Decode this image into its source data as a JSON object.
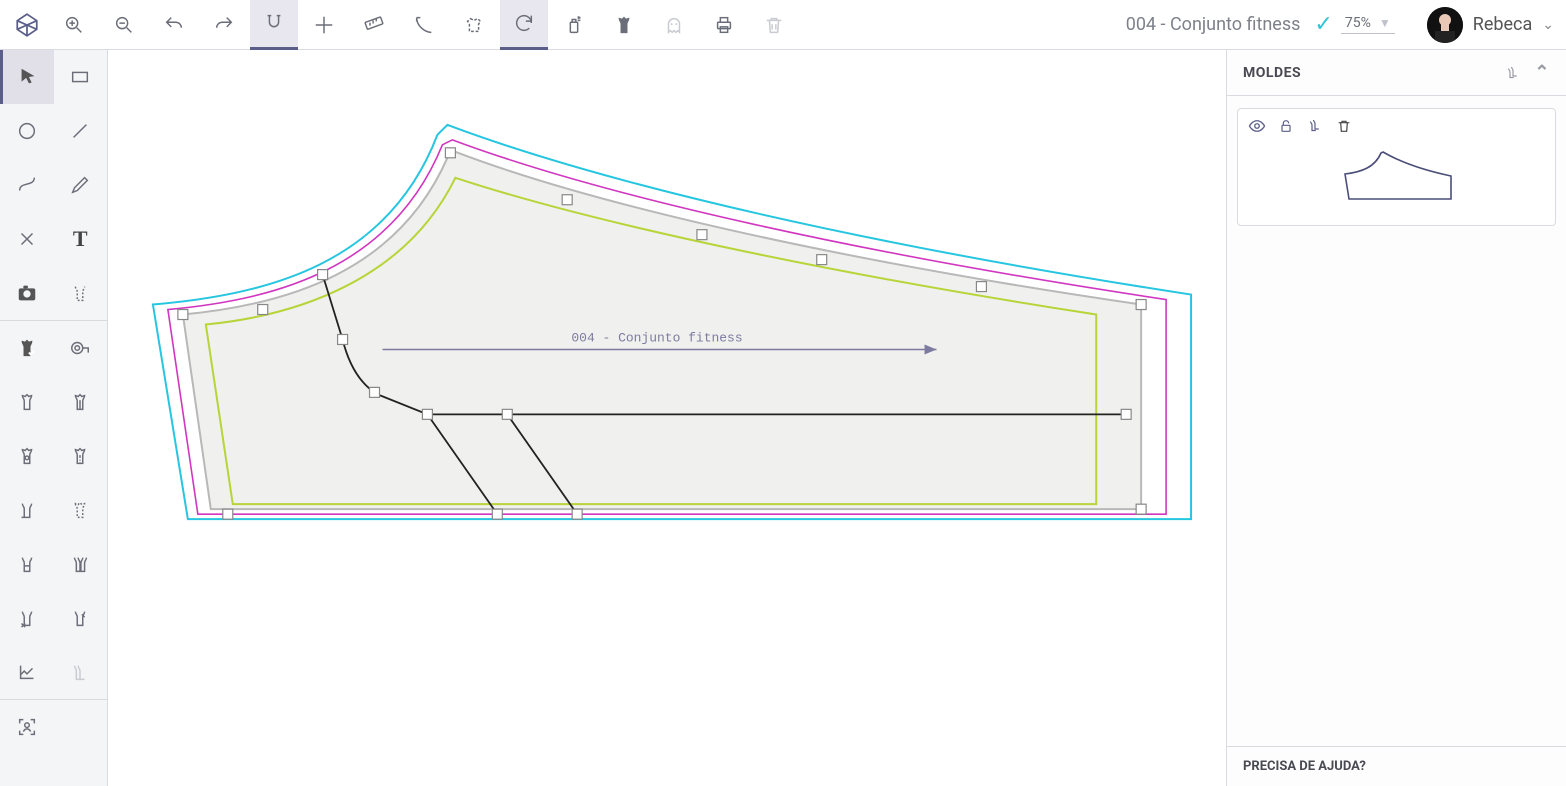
{
  "header": {
    "doc_title": "004 - Conjunto fitness",
    "zoom": "75%",
    "user_name": "Rebeca"
  },
  "right_panel": {
    "title": "MOLDES",
    "help": "PRECISA DE AJUDA?"
  },
  "canvas": {
    "label": "004 - Conjunto fitness"
  },
  "top_tools": [
    {
      "name": "zoom-in-icon"
    },
    {
      "name": "zoom-out-icon"
    },
    {
      "name": "undo-icon"
    },
    {
      "name": "redo-icon"
    },
    {
      "name": "snap-icon",
      "active": true
    },
    {
      "name": "crosshair-icon"
    },
    {
      "name": "ruler-icon"
    },
    {
      "name": "curve-tool-icon"
    },
    {
      "name": "shirt-select-icon"
    },
    {
      "name": "refresh-icon",
      "active": true
    },
    {
      "name": "spray-icon"
    },
    {
      "name": "tank-fill-icon"
    },
    {
      "name": "ghost-icon",
      "disabled": true
    },
    {
      "name": "print-icon"
    },
    {
      "name": "trash-icon",
      "disabled": true
    }
  ],
  "side_tools": [
    [
      {
        "name": "select-tool",
        "active": true
      },
      {
        "name": "rectangle-tool"
      }
    ],
    [
      {
        "name": "circle-tool"
      },
      {
        "name": "line-tool"
      }
    ],
    [
      {
        "name": "curve-tool"
      },
      {
        "name": "pencil-tool"
      }
    ],
    [
      {
        "name": "close-tool"
      },
      {
        "name": "text-tool"
      }
    ],
    [
      {
        "name": "camera-tool"
      },
      {
        "name": "pattern-tool"
      }
    ],
    "sep",
    [
      {
        "name": "tank-check-tool"
      },
      {
        "name": "measure-tape-tool"
      }
    ],
    [
      {
        "name": "tank-tool-1"
      },
      {
        "name": "tank-tool-2"
      }
    ],
    [
      {
        "name": "tank-tool-3"
      },
      {
        "name": "tank-tool-4"
      }
    ],
    [
      {
        "name": "tank-tool-5"
      },
      {
        "name": "tank-tool-6"
      }
    ],
    [
      {
        "name": "tank-tool-7"
      },
      {
        "name": "tank-tool-8"
      }
    ],
    [
      {
        "name": "tank-tool-9"
      },
      {
        "name": "tank-tool-10"
      }
    ],
    [
      {
        "name": "graph-tool"
      },
      {
        "name": "tank-tool-11",
        "disabled": true
      }
    ],
    "sep",
    [
      {
        "name": "scan-tool"
      },
      {
        "name": "",
        "empty": true
      }
    ]
  ]
}
